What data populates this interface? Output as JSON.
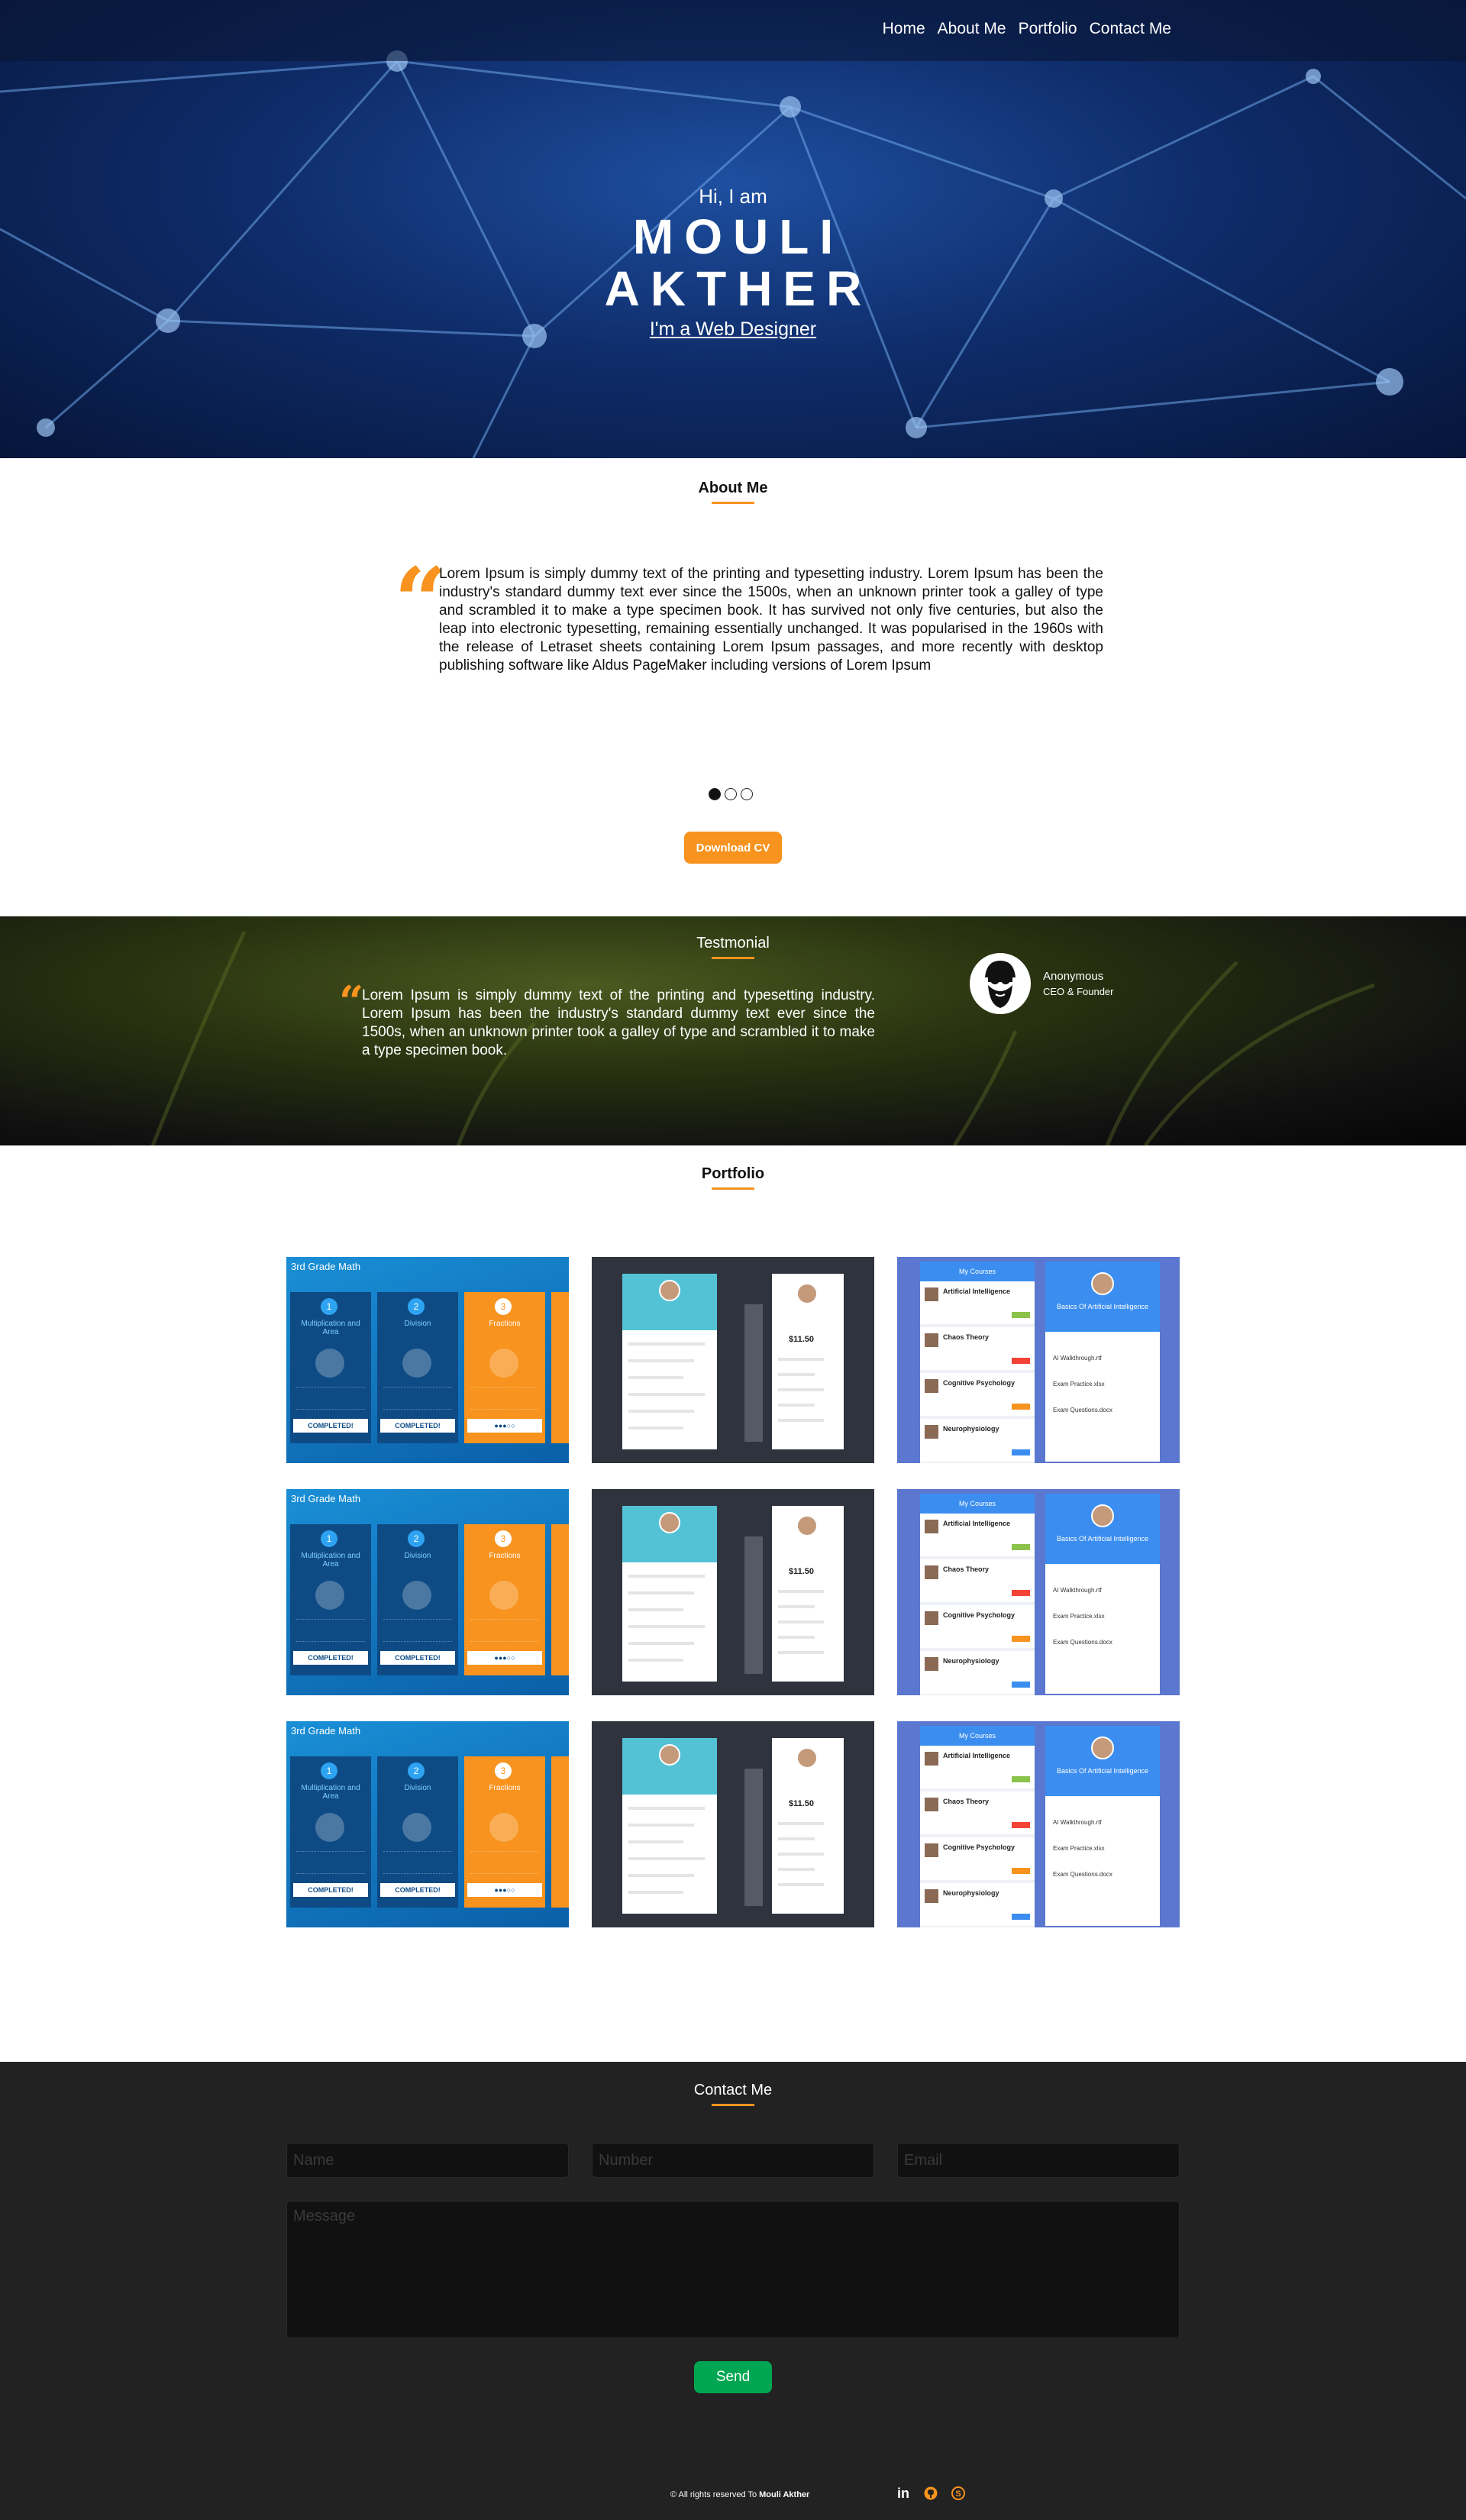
{
  "nav": {
    "items": [
      "Home",
      "About Me",
      "Portfolio",
      "Contact Me"
    ]
  },
  "hero": {
    "greeting": "Hi, I am",
    "first_name": "MOULI",
    "last_name": "AKTHER",
    "role": "I'm a Web Designer"
  },
  "about": {
    "title": "About Me",
    "quote_glyph": "“",
    "text": "Lorem Ipsum is simply dummy text of the printing and typesetting industry. Lorem Ipsum has been the industry's standard dummy text ever since the 1500s, when an unknown printer took a galley of type and scrambled it to make a type specimen book. It has survived not only five centuries, but also the leap into electronic typesetting, remaining essentially unchanged. It was popularised in the 1960s with the release of Letraset sheets containing Lorem Ipsum passages, and more recently with desktop publishing software like Aldus PageMaker including versions of Lorem Ipsum",
    "slider_active_index": 0,
    "slider_count": 3,
    "cv_button": "Download CV"
  },
  "testimonial": {
    "title": "Testmonial",
    "quote_glyph": "“",
    "text": "Lorem Ipsum is simply dummy text of the printing and typesetting industry. Lorem Ipsum has been the industry's standard dummy text ever since the 1500s, when an unknown printer took a galley of type and scrambled it to make a type specimen book.",
    "author": "Anonymous",
    "author_role": "CEO & Founder"
  },
  "portfolio": {
    "title": "Portfolio",
    "math_card": {
      "title": "3rd Grade Math",
      "columns": [
        {
          "num": "1",
          "label": "Multiplication and Area",
          "button": "COMPLETED!"
        },
        {
          "num": "2",
          "label": "Division",
          "button": "COMPLETED!"
        },
        {
          "num": "3",
          "label": "Fractions",
          "button": ""
        }
      ]
    },
    "profile_card": {
      "price": "$11.50"
    },
    "courses_card": {
      "header": "My Courses",
      "items": [
        "Artificial Intelligence",
        "Chaos Theory",
        "Cognitive Psychology",
        "Neurophysiology"
      ],
      "detail_title": "Basics Of Artificial Intelligence",
      "files": [
        "AI Walkthrough.rtf",
        "Exam Practice.xlsx",
        "Exam Questions.docx"
      ]
    }
  },
  "contact": {
    "title": "Contact Me",
    "name_placeholder": "Name",
    "number_placeholder": "Number",
    "email_placeholder": "Email",
    "message_placeholder": "Message",
    "send_button": "Send"
  },
  "footer": {
    "copyright_prefix": "© All rights reserved To",
    "copyright_name": "Mouli Akther",
    "linkedin_glyph": "in",
    "icon_color": "#f7931e"
  },
  "colors": {
    "accent": "#f7931e",
    "send": "#00a651",
    "contact_bg": "#222222"
  }
}
